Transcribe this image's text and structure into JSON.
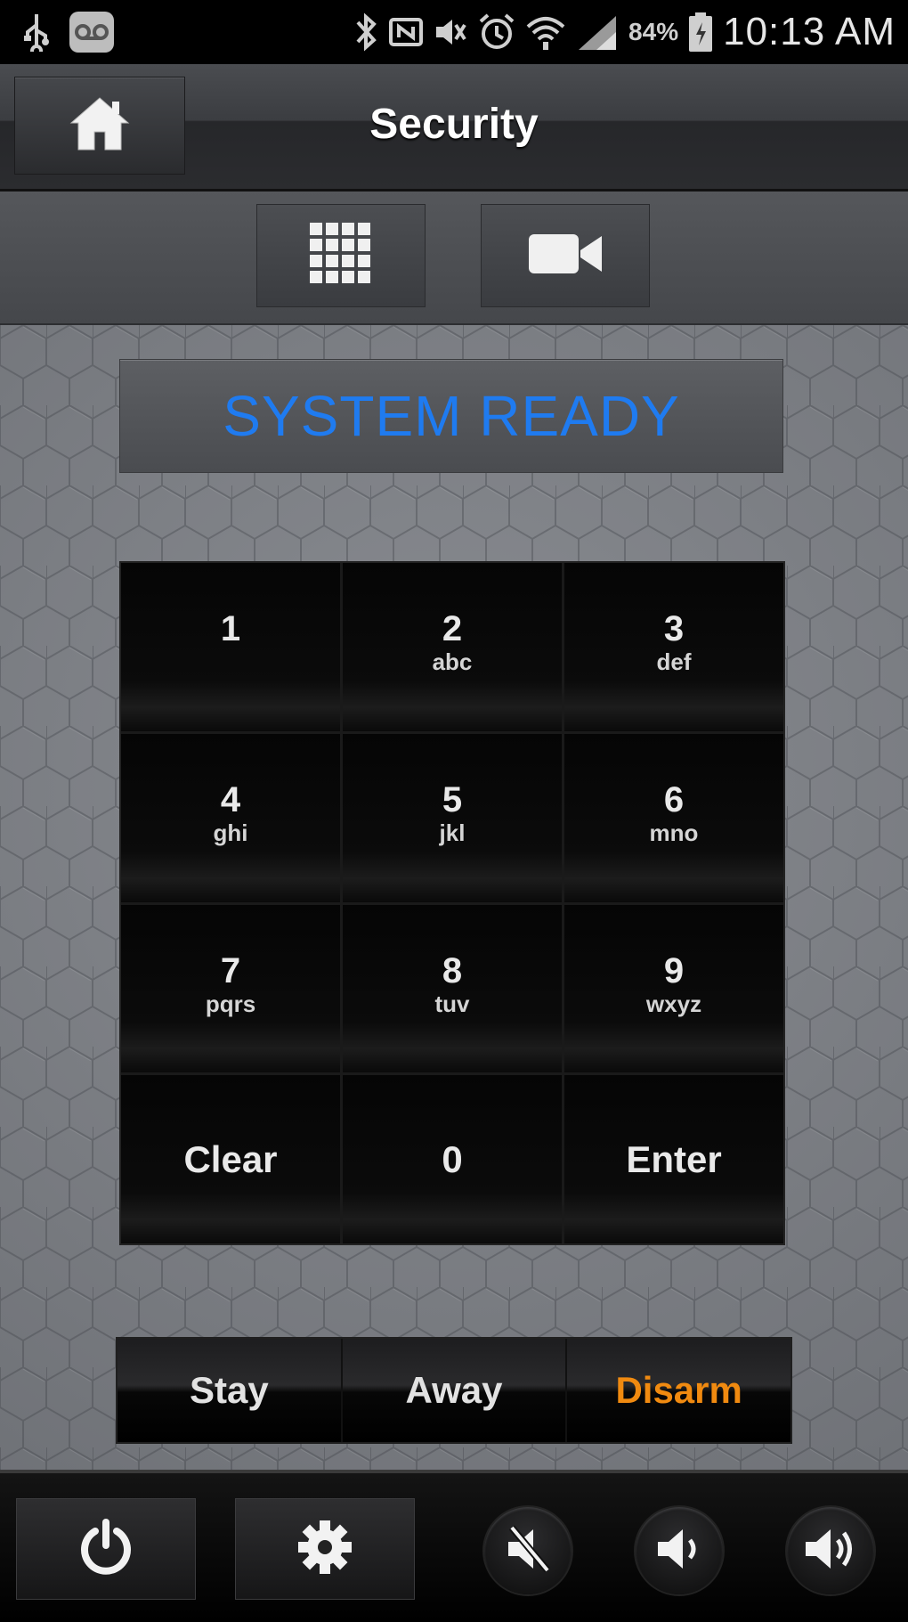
{
  "status_bar": {
    "battery": "84%",
    "time": "10:13 AM",
    "icons": [
      "usb-icon",
      "voicemail-icon",
      "bluetooth-icon",
      "nfc-icon",
      "mute-icon",
      "alarm-icon",
      "wifi-icon",
      "signal-icon",
      "battery-icon"
    ]
  },
  "header": {
    "title": "Security",
    "home_icon": "home-icon"
  },
  "view_switch": {
    "keypad_icon": "keypad-icon",
    "camera_icon": "camera-icon"
  },
  "status_message": "SYSTEM READY",
  "status_color": "#1f7bf0",
  "keypad": {
    "keys": [
      {
        "number": "1",
        "letters": ""
      },
      {
        "number": "2",
        "letters": "abc"
      },
      {
        "number": "3",
        "letters": "def"
      },
      {
        "number": "4",
        "letters": "ghi"
      },
      {
        "number": "5",
        "letters": "jkl"
      },
      {
        "number": "6",
        "letters": "mno"
      },
      {
        "number": "7",
        "letters": "pqrs"
      },
      {
        "number": "8",
        "letters": "tuv"
      },
      {
        "number": "9",
        "letters": "wxyz"
      },
      {
        "number": "Clear",
        "letters": ""
      },
      {
        "number": "0",
        "letters": ""
      },
      {
        "number": "Enter",
        "letters": ""
      }
    ]
  },
  "modes": {
    "stay": "Stay",
    "away": "Away",
    "disarm": "Disarm",
    "disarm_color": "#f08a10"
  },
  "bottom_bar": {
    "icons": [
      "power-icon",
      "settings-icon",
      "mute-volume-icon",
      "volume-down-icon",
      "volume-up-icon"
    ]
  }
}
